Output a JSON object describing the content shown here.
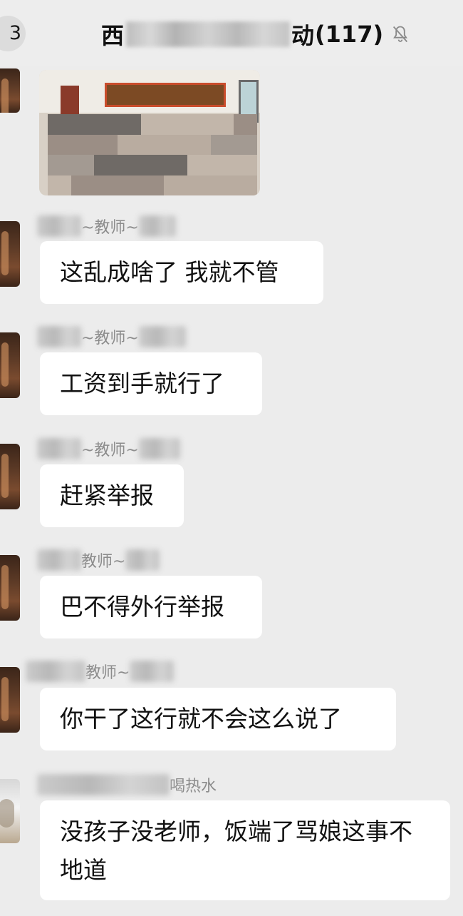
{
  "header": {
    "back_count": "3",
    "title_start": "西",
    "title_end": "动",
    "member_count": "(117)",
    "mute_icon": "bell-muted-icon"
  },
  "messages": [
    {
      "type": "image",
      "content_description_hidden": ""
    },
    {
      "sender_role": "~教师~",
      "text": "这乱成啥了 我就不管"
    },
    {
      "sender_role": "~教师~",
      "text": "工资到手就行了"
    },
    {
      "sender_role": "~教师~",
      "text": "赶紧举报"
    },
    {
      "sender_role": "教师~",
      "text": "巴不得外行举报"
    },
    {
      "sender_role": "教师~",
      "text": "你干了这行就不会这么说了"
    },
    {
      "sender_role": "喝热水",
      "text": "没孩子没老师，饭端了骂娘这事不地道"
    }
  ],
  "colors": {
    "background": "#ececec",
    "bubble": "#ffffff",
    "name_text": "#8c8c8c"
  }
}
